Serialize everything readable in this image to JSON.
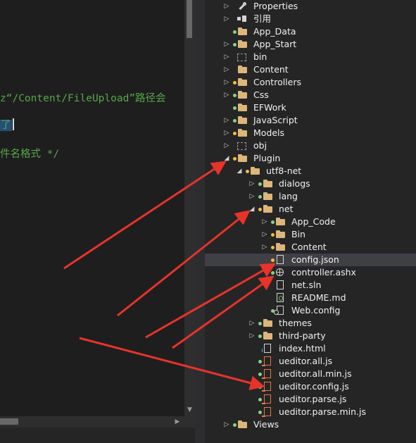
{
  "editor": {
    "lines": [
      {
        "text": "z“/Content/FileUpload”路径会"
      },
      {
        "text": "了",
        "selected": true
      },
      {
        "text": "件名格式 */"
      }
    ]
  },
  "explorer": {
    "rows": [
      {
        "label": "Properties",
        "depth": 0,
        "twisty": "collapsed",
        "status": "none",
        "icon": "wrench-icon"
      },
      {
        "label": "引用",
        "depth": 0,
        "twisty": "collapsed",
        "status": "none",
        "icon": "references-icon"
      },
      {
        "label": "App_Data",
        "depth": 0,
        "twisty": "none",
        "status": "green",
        "icon": "folder-icon"
      },
      {
        "label": "App_Start",
        "depth": 0,
        "twisty": "collapsed",
        "status": "green",
        "icon": "folder-icon"
      },
      {
        "label": "bin",
        "depth": 0,
        "twisty": "collapsed",
        "status": "none",
        "icon": "folder-excluded-icon"
      },
      {
        "label": "Content",
        "depth": 0,
        "twisty": "collapsed",
        "status": "none",
        "icon": "folder-icon"
      },
      {
        "label": "Controllers",
        "depth": 0,
        "twisty": "collapsed",
        "status": "yellow",
        "icon": "folder-icon"
      },
      {
        "label": "Css",
        "depth": 0,
        "twisty": "collapsed",
        "status": "green",
        "icon": "folder-icon"
      },
      {
        "label": "EFWork",
        "depth": 0,
        "twisty": "none",
        "status": "green",
        "icon": "folder-icon"
      },
      {
        "label": "JavaScript",
        "depth": 0,
        "twisty": "collapsed",
        "status": "green",
        "icon": "folder-icon"
      },
      {
        "label": "Models",
        "depth": 0,
        "twisty": "collapsed",
        "status": "yellow",
        "icon": "folder-icon"
      },
      {
        "label": "obj",
        "depth": 0,
        "twisty": "collapsed",
        "status": "none",
        "icon": "folder-excluded-icon"
      },
      {
        "label": "Plugin",
        "depth": 0,
        "twisty": "expanded",
        "status": "yellow",
        "icon": "folder-icon"
      },
      {
        "label": "utf8-net",
        "depth": 1,
        "twisty": "expanded",
        "status": "yellow",
        "icon": "folder-icon"
      },
      {
        "label": "dialogs",
        "depth": 2,
        "twisty": "collapsed",
        "status": "green",
        "icon": "folder-icon"
      },
      {
        "label": "lang",
        "depth": 2,
        "twisty": "collapsed",
        "status": "green",
        "icon": "folder-icon"
      },
      {
        "label": "net",
        "depth": 2,
        "twisty": "expanded",
        "status": "yellow",
        "icon": "folder-icon"
      },
      {
        "label": "App_Code",
        "depth": 3,
        "twisty": "collapsed",
        "status": "green",
        "icon": "folder-icon"
      },
      {
        "label": "Bin",
        "depth": 3,
        "twisty": "collapsed",
        "status": "yellow",
        "icon": "folder-icon"
      },
      {
        "label": "Content",
        "depth": 3,
        "twisty": "collapsed",
        "status": "yellow",
        "icon": "folder-icon"
      },
      {
        "label": "config.json",
        "depth": 3,
        "twisty": "none",
        "status": "yellow",
        "icon": "json-file-icon",
        "selected": true
      },
      {
        "label": "controller.ashx",
        "depth": 3,
        "twisty": "none",
        "status": "green",
        "icon": "globe-file-icon"
      },
      {
        "label": "net.sln",
        "depth": 3,
        "twisty": "none",
        "status": "none",
        "icon": "file-icon"
      },
      {
        "label": "README.md",
        "depth": 3,
        "twisty": "none",
        "status": "none",
        "icon": "markdown-file-icon"
      },
      {
        "label": "Web.config",
        "depth": 3,
        "twisty": "none",
        "status": "green",
        "icon": "config-file-icon"
      },
      {
        "label": "themes",
        "depth": 2,
        "twisty": "collapsed",
        "status": "green",
        "icon": "folder-icon"
      },
      {
        "label": "third-party",
        "depth": 2,
        "twisty": "collapsed",
        "status": "green",
        "icon": "folder-icon"
      },
      {
        "label": "index.html",
        "depth": 2,
        "twisty": "none",
        "status": "none",
        "icon": "html-file-icon"
      },
      {
        "label": "ueditor.all.js",
        "depth": 2,
        "twisty": "none",
        "status": "green",
        "icon": "js-file-icon"
      },
      {
        "label": "ueditor.all.min.js",
        "depth": 2,
        "twisty": "none",
        "status": "green",
        "icon": "js-file-icon"
      },
      {
        "label": "ueditor.config.js",
        "depth": 2,
        "twisty": "none",
        "status": "green",
        "icon": "js-file-icon"
      },
      {
        "label": "ueditor.parse.js",
        "depth": 2,
        "twisty": "none",
        "status": "green",
        "icon": "js-file-icon"
      },
      {
        "label": "ueditor.parse.min.js",
        "depth": 2,
        "twisty": "none",
        "status": "green",
        "icon": "js-file-icon"
      },
      {
        "label": "Views",
        "depth": 0,
        "twisty": "collapsed",
        "status": "green",
        "icon": "folder-icon"
      }
    ]
  },
  "annotation_color": "#e8332a"
}
